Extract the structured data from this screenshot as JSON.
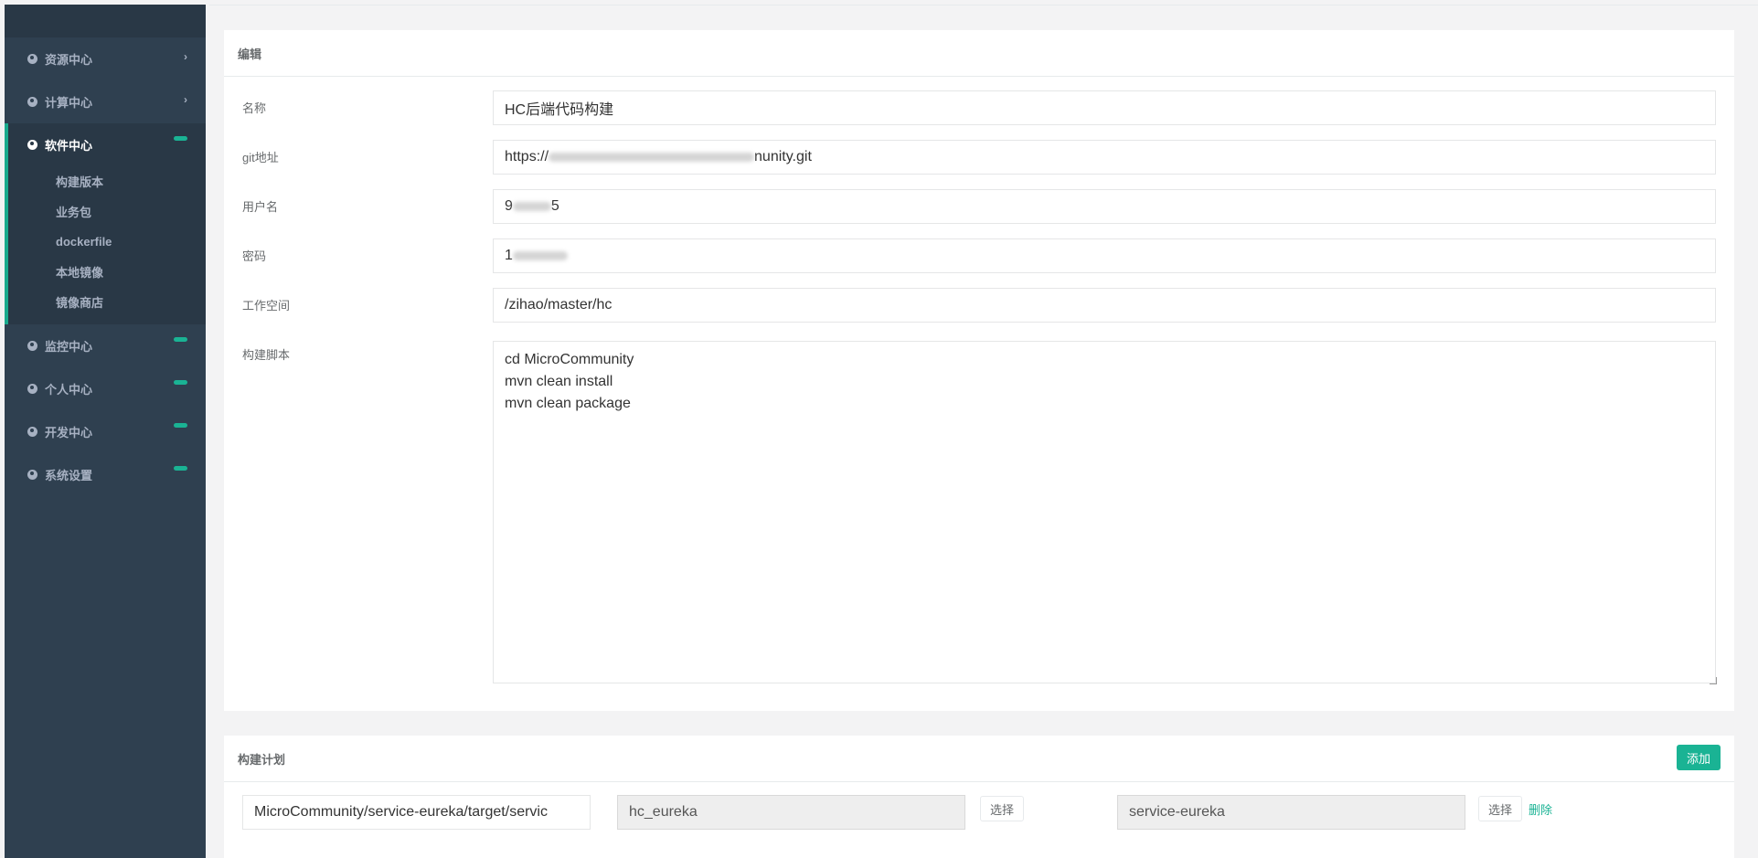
{
  "sidebar": {
    "items": [
      {
        "label": "资源中心"
      },
      {
        "label": "计算中心"
      },
      {
        "label": "软件中心",
        "children": [
          "构建版本",
          "业务包",
          "dockerfile",
          "本地镜像",
          "镜像商店"
        ]
      },
      {
        "label": "监控中心"
      },
      {
        "label": "个人中心"
      },
      {
        "label": "开发中心"
      },
      {
        "label": "系统设置"
      }
    ]
  },
  "edit": {
    "title": "编辑",
    "name_label": "名称",
    "name_value": "HC后端代码构建",
    "git_label": "git地址",
    "git_prefix": "https://",
    "git_suffix": "nunity.git",
    "user_label": "用户名",
    "user_prefix": "9",
    "user_suffix": "5",
    "password_label": "密码",
    "password_prefix": "1",
    "workspace_label": "工作空间",
    "workspace_value": "/zihao/master/hc",
    "script_label": "构建脚本",
    "script_value": "cd MicroCommunity\nmvn clean install\nmvn clean package"
  },
  "plan": {
    "title": "构建计划",
    "add_label": "添加",
    "path_value": "MicroCommunity/service-eureka/target/servic",
    "package_value": "hc_eureka",
    "select_label_1": "选择",
    "service_value": "service-eureka",
    "select_label_2": "选择",
    "delete_label": "删除"
  },
  "colors": {
    "sidebar_bg": "#2f4050",
    "accent": "#1ab394"
  }
}
